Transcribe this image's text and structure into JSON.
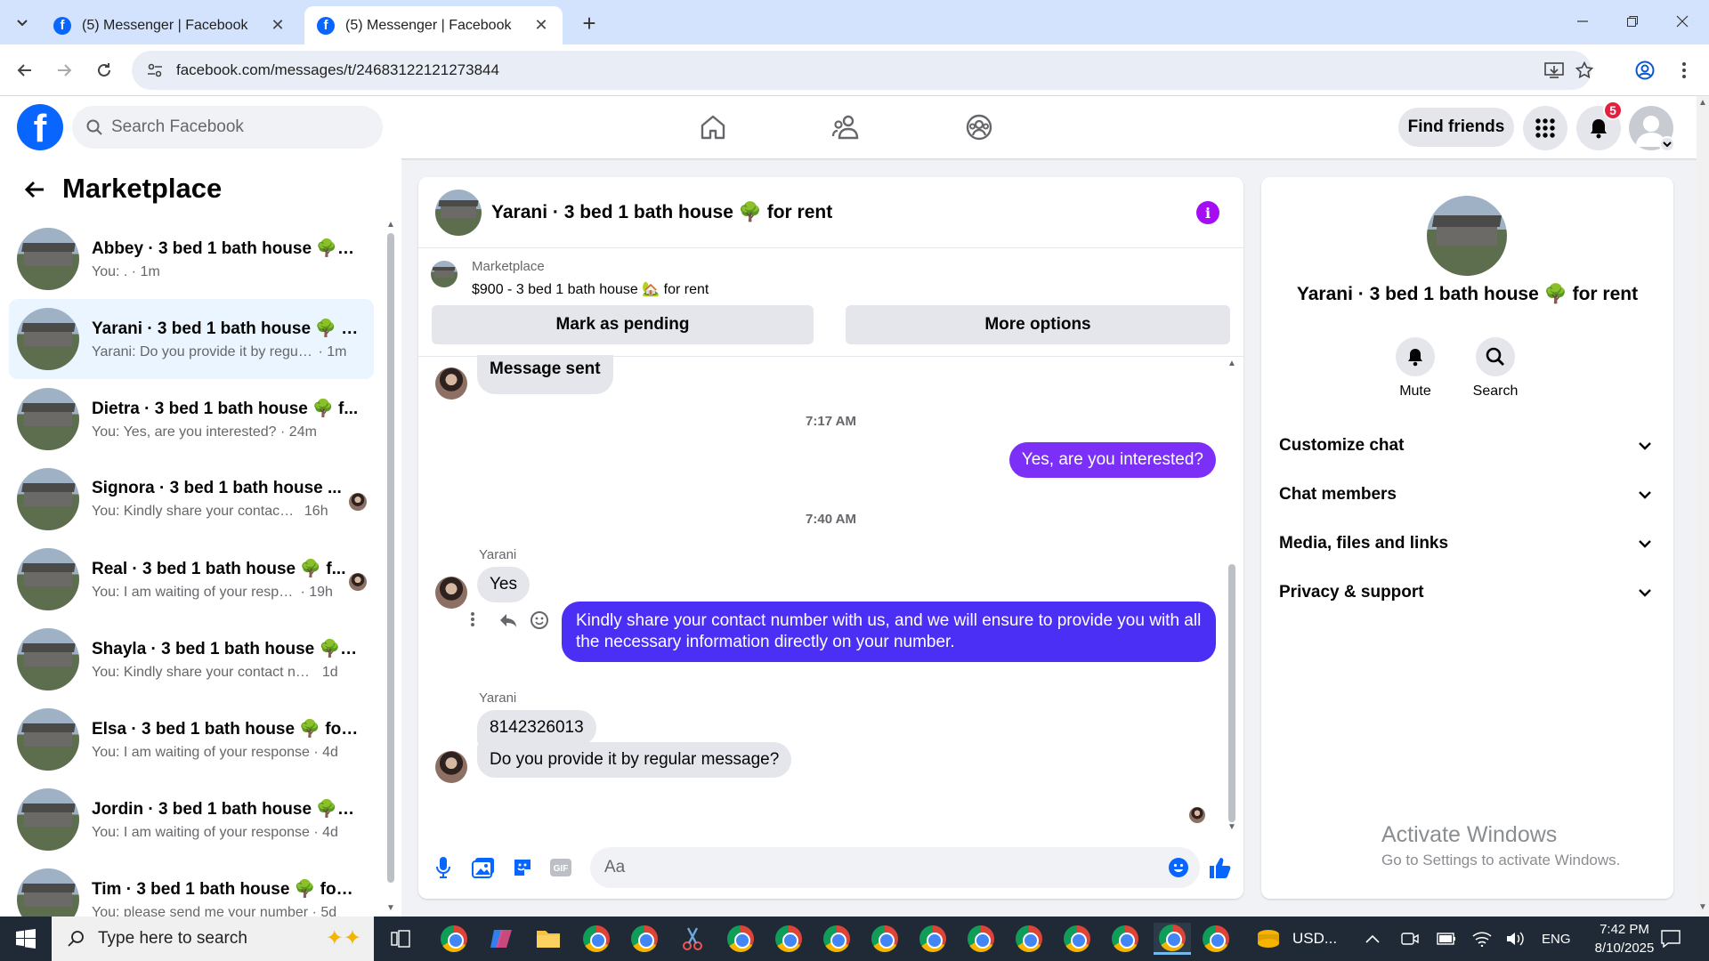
{
  "browser": {
    "tabs": [
      {
        "title": "(5) Messenger | Facebook"
      },
      {
        "title": "(5) Messenger | Facebook"
      }
    ],
    "url": "facebook.com/messages/t/24683122121273844"
  },
  "header": {
    "search_placeholder": "Search Facebook",
    "find_friends": "Find friends",
    "notifications_count": "5"
  },
  "sidebar": {
    "title": "Marketplace",
    "conversations": [
      {
        "name": "Abbey · 3 bed 1 bath house 🌳 f...",
        "preview": "You: .",
        "time": "· 1m"
      },
      {
        "name": "Yarani · 3 bed 1 bath house 🌳 f...",
        "preview": "Yarani: Do you provide it by regula...",
        "time": "· 1m"
      },
      {
        "name": "Dietra · 3 bed 1 bath house 🌳 f...",
        "preview": "You: Yes, are you interested?",
        "time": "· 24m"
      },
      {
        "name": "Signora · 3 bed 1 bath house ...",
        "preview": "You: Kindly share your contact ...",
        "time": "16h"
      },
      {
        "name": "Real · 3 bed 1 bath house 🌳 f...",
        "preview": "You: I am waiting of your respo...",
        "time": "· 19h"
      },
      {
        "name": "Shayla · 3 bed 1 bath house 🌳 f...",
        "preview": "You: Kindly share your contact num...",
        "time": "1d"
      },
      {
        "name": "Elsa · 3 bed 1 bath house 🌳 for ...",
        "preview": "You: I am waiting of your response",
        "time": "· 4d"
      },
      {
        "name": "Jordin · 3 bed 1 bath house 🌳 f...",
        "preview": "You: I am waiting of your response",
        "time": "· 4d"
      },
      {
        "name": "Tim · 3 bed 1 bath house 🌳 for ...",
        "preview": "You: please send me your number",
        "time": "· 5d"
      }
    ]
  },
  "chat": {
    "title": "Yarani · 3 bed 1 bath house 🌳 for rent",
    "marketplace_label": "Marketplace",
    "listing": "$900 - 3 bed 1 bath house 🏡 for rent",
    "mark_pending": "Mark as pending",
    "more_options": "More options",
    "messages": {
      "m1": "Message sent",
      "t1": "7:17 AM",
      "m2": "Yes, are you interested?",
      "t2": "7:40 AM",
      "sender1": "Yarani",
      "m3": "Yes",
      "m4": "Kindly share your contact number with us, and we will ensure to provide you with all the necessary information directly on your number.",
      "sender2": "Yarani",
      "m5": "8142326013",
      "m6": "Do you provide it by regular message?"
    },
    "composer_placeholder": "Aa"
  },
  "details": {
    "name": "Yarani · 3 bed 1 bath house 🌳 for rent",
    "mute": "Mute",
    "search": "Search",
    "sections": [
      "Customize chat",
      "Chat members",
      "Media, files and links",
      "Privacy & support"
    ],
    "watermark_title": "Activate Windows",
    "watermark_sub": "Go to Settings to activate Windows."
  },
  "taskbar": {
    "search_placeholder": "Type here to search",
    "currency": "USD...",
    "lang": "ENG",
    "time": "7:42 PM",
    "date": "8/10/2025"
  },
  "colors": {
    "fb_blue": "#0866ff",
    "outgoing": "#7b2ff7",
    "accent_purple": "#a30ff2"
  }
}
